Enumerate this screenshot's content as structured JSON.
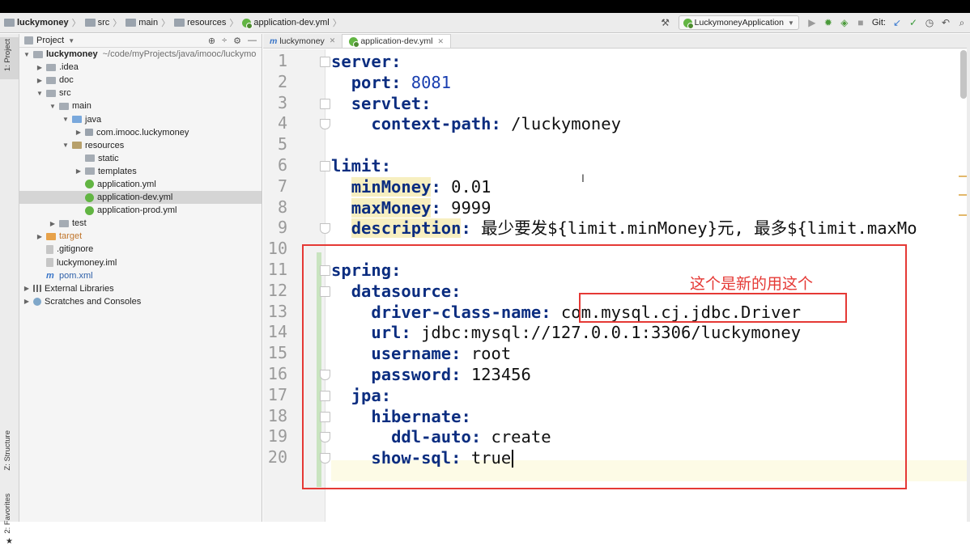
{
  "breadcrumbs": [
    {
      "label": "luckymoney",
      "icon": "folder-icon",
      "bold": true
    },
    {
      "label": "src",
      "icon": "folder-icon"
    },
    {
      "label": "main",
      "icon": "folder-icon"
    },
    {
      "label": "resources",
      "icon": "folder-icon"
    },
    {
      "label": "application-dev.yml",
      "icon": "yaml-file-icon"
    }
  ],
  "toolbar": {
    "run_config": "LuckymoneyApplication",
    "git_label": "Git:"
  },
  "side_tabs": {
    "project": "1: Project",
    "structure": "Z: Structure",
    "favorites": "2: Favorites"
  },
  "project_panel": {
    "title": "Project",
    "root": {
      "label": "luckymoney",
      "path": "~/code/myProjects/java/imooc/luckymo"
    },
    "items": [
      {
        "label": ".idea",
        "depth": 1,
        "arrow": "right",
        "icon": "folder"
      },
      {
        "label": "doc",
        "depth": 1,
        "arrow": "right",
        "icon": "folder"
      },
      {
        "label": "src",
        "depth": 1,
        "arrow": "down",
        "icon": "folder"
      },
      {
        "label": "main",
        "depth": 2,
        "arrow": "down",
        "icon": "folder"
      },
      {
        "label": "java",
        "depth": 3,
        "arrow": "down",
        "icon": "folder-blue"
      },
      {
        "label": "com.imooc.luckymoney",
        "depth": 4,
        "arrow": "right",
        "icon": "pkg"
      },
      {
        "label": "resources",
        "depth": 3,
        "arrow": "down",
        "icon": "folder-res"
      },
      {
        "label": "static",
        "depth": 4,
        "arrow": "",
        "icon": "folder"
      },
      {
        "label": "templates",
        "depth": 4,
        "arrow": "right",
        "icon": "folder"
      },
      {
        "label": "application.yml",
        "depth": 4,
        "arrow": "",
        "icon": "yml"
      },
      {
        "label": "application-dev.yml",
        "depth": 4,
        "arrow": "",
        "icon": "yml",
        "selected": true
      },
      {
        "label": "application-prod.yml",
        "depth": 4,
        "arrow": "",
        "icon": "yml"
      },
      {
        "label": "test",
        "depth": 2,
        "arrow": "right",
        "icon": "folder"
      },
      {
        "label": "target",
        "depth": 1,
        "arrow": "right",
        "icon": "folder-orange",
        "color": "orange"
      },
      {
        "label": ".gitignore",
        "depth": 1,
        "arrow": "",
        "icon": "file"
      },
      {
        "label": "luckymoney.iml",
        "depth": 1,
        "arrow": "",
        "icon": "file"
      },
      {
        "label": "pom.xml",
        "depth": 1,
        "arrow": "",
        "icon": "m",
        "color": "blue"
      },
      {
        "label": "External Libraries",
        "depth": 0,
        "arrow": "right",
        "icon": "lib"
      },
      {
        "label": "Scratches and Consoles",
        "depth": 0,
        "arrow": "right",
        "icon": "scr"
      }
    ]
  },
  "editor": {
    "tabs": [
      {
        "label": "luckymoney",
        "icon": "m",
        "active": false
      },
      {
        "label": "application-dev.yml",
        "icon": "yml",
        "active": true
      }
    ],
    "lines": [
      {
        "n": "1",
        "indent": 0,
        "key": "server",
        "value": ""
      },
      {
        "n": "2",
        "indent": 1,
        "key": "port",
        "value": "8081",
        "value_style": "num"
      },
      {
        "n": "3",
        "indent": 1,
        "key": "servlet",
        "value": ""
      },
      {
        "n": "4",
        "indent": 2,
        "key": "context-path",
        "value": "/luckymoney"
      },
      {
        "n": "5",
        "indent": 0,
        "key": "",
        "value": ""
      },
      {
        "n": "6",
        "indent": 0,
        "key": "limit",
        "value": ""
      },
      {
        "n": "7",
        "indent": 1,
        "key": "minMoney",
        "value": "0.01",
        "hl": true
      },
      {
        "n": "8",
        "indent": 1,
        "key": "maxMoney",
        "value": "9999",
        "hl": true
      },
      {
        "n": "9",
        "indent": 1,
        "key": "description",
        "value": "最少要发${limit.minMoney}元, 最多${limit.maxMo",
        "hl": true
      },
      {
        "n": "10",
        "indent": 0,
        "key": "",
        "value": ""
      },
      {
        "n": "11",
        "indent": 0,
        "key": "spring",
        "value": ""
      },
      {
        "n": "12",
        "indent": 1,
        "key": "datasource",
        "value": ""
      },
      {
        "n": "13",
        "indent": 2,
        "key": "driver-class-name",
        "value": "com.mysql.cj.jdbc.Driver"
      },
      {
        "n": "14",
        "indent": 2,
        "key": "url",
        "value": "jdbc:mysql://127.0.0.1:3306/luckymoney"
      },
      {
        "n": "15",
        "indent": 2,
        "key": "username",
        "value": "root"
      },
      {
        "n": "16",
        "indent": 2,
        "key": "password",
        "value": "123456"
      },
      {
        "n": "17",
        "indent": 1,
        "key": "jpa",
        "value": ""
      },
      {
        "n": "18",
        "indent": 2,
        "key": "hibernate",
        "value": ""
      },
      {
        "n": "19",
        "indent": 3,
        "key": "ddl-auto",
        "value": "create"
      },
      {
        "n": "20",
        "indent": 2,
        "key": "show-sql",
        "value": "true"
      }
    ]
  },
  "annotation": {
    "text": "这个是新的用这个",
    "color": "#e53935"
  }
}
